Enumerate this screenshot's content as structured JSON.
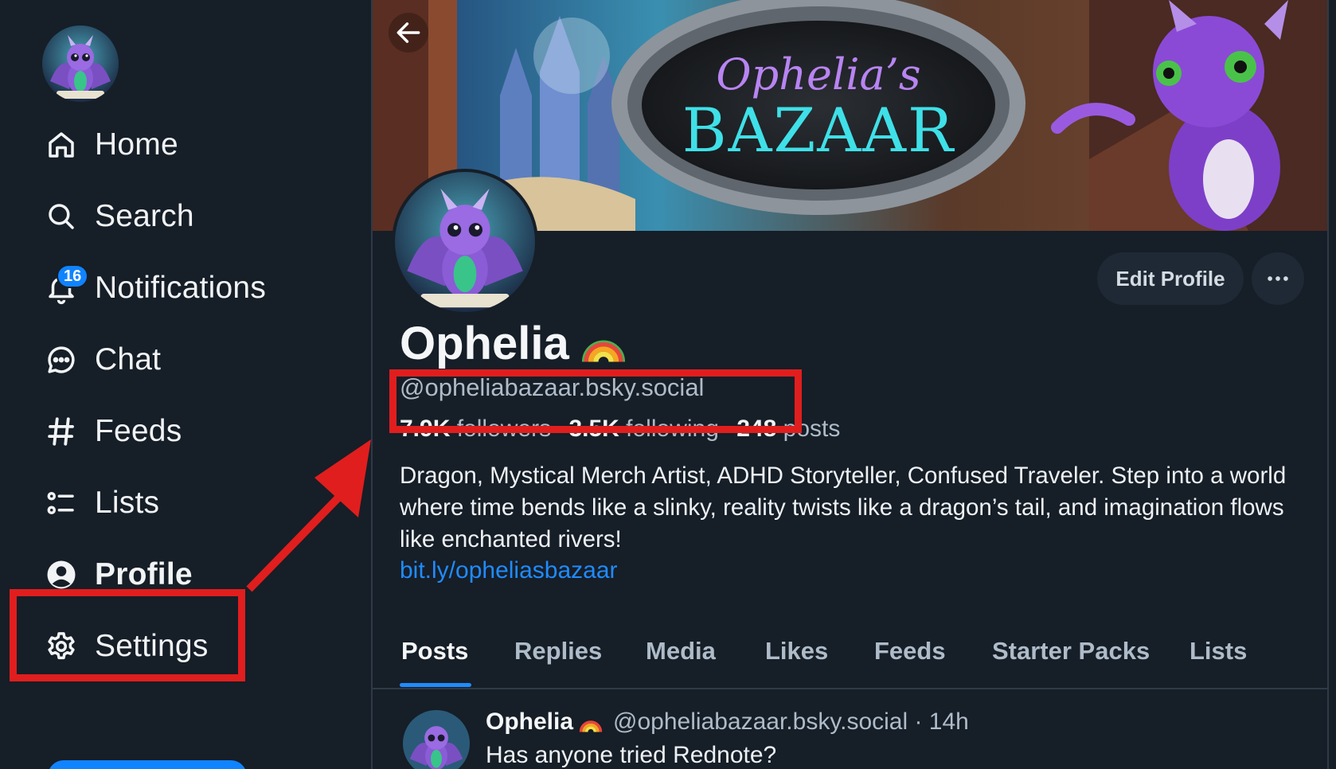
{
  "colors": {
    "background": "#161e27",
    "accent": "#208bfe",
    "annotation": "#e01e1e"
  },
  "sidebar": {
    "items": [
      {
        "label": "Home",
        "icon": "home-icon"
      },
      {
        "label": "Search",
        "icon": "search-icon"
      },
      {
        "label": "Notifications",
        "icon": "bell-icon",
        "badge": "16"
      },
      {
        "label": "Chat",
        "icon": "chat-icon"
      },
      {
        "label": "Feeds",
        "icon": "hashtag-icon"
      },
      {
        "label": "Lists",
        "icon": "list-icon"
      },
      {
        "label": "Profile",
        "icon": "user-circle-icon",
        "active": true
      },
      {
        "label": "Settings",
        "icon": "gear-icon"
      }
    ]
  },
  "banner": {
    "script_text": "Ophelia’s",
    "title_text": "BAZAAR"
  },
  "profile": {
    "display_name": "Ophelia",
    "handle": "@opheliabazaar.bsky.social",
    "followers_count": "7.9K",
    "followers_label": "followers",
    "following_count": "3.5K",
    "following_label": "following",
    "posts_count": "248",
    "posts_label": "posts",
    "bio": "Dragon, Mystical Merch Artist, ADHD Storyteller, Confused Traveler. Step into a world where time bends like a slinky, reality twists like a dragon’s tail, and imagination flows like enchanted rivers!",
    "link": "bit.ly/opheliasbazaar",
    "edit_label": "Edit Profile"
  },
  "tabs": [
    "Posts",
    "Replies",
    "Media",
    "Likes",
    "Feeds",
    "Starter Packs",
    "Lists"
  ],
  "post": {
    "author": "Ophelia",
    "meta": "@opheliabazaar.bsky.social · 14h",
    "text": "Has anyone tried Rednote?"
  }
}
